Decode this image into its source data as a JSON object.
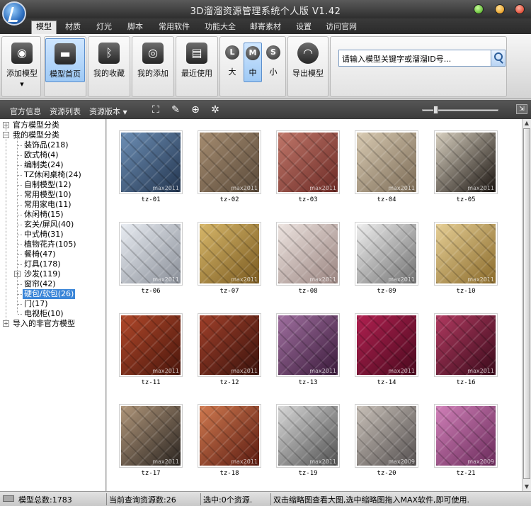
{
  "app": {
    "title": "3D溜溜资源管理系统个人版 V1.42"
  },
  "menu_tabs": [
    "模型",
    "材质",
    "灯光",
    "脚本",
    "常用软件",
    "功能大全",
    "邮寄素材",
    "设置",
    "访问官网"
  ],
  "ribbon": {
    "add_model": "添加模型",
    "model_home": "模型首页",
    "my_favorites": "我的收藏",
    "my_added": "我的添加",
    "recent": "最近使用",
    "size_large_letter": "L",
    "size_large": "大",
    "size_medium_letter": "M",
    "size_medium": "中",
    "size_small_letter": "S",
    "size_small": "小",
    "export_model": "导出模型",
    "search_value": "请输入模型关键字或溜溜ID号..."
  },
  "subtoolbar": {
    "official_info": "官方信息",
    "resource_list": "资源列表",
    "resource_version": "资源版本"
  },
  "tree": {
    "official": "官方模型分类",
    "mine": "我的模型分类",
    "items": [
      "装饰品(218)",
      "欧式椅(4)",
      "编制类(24)",
      "TZ休闲桌椅(24)",
      "自制模型(12)",
      "常用模型(10)",
      "常用家电(11)",
      "休闲椅(15)",
      "玄关/屏风(40)",
      "中式椅(31)",
      "植物花卉(105)",
      "餐椅(47)",
      "灯具(178)",
      "沙发(119)",
      "窗帘(42)",
      "硬包/软包(26)",
      "门(17)",
      "电视柜(10)"
    ],
    "imported": "导入的非官方模型"
  },
  "thumbs": [
    {
      "label": "tz-01",
      "wm": "max2011",
      "c1": "#243650",
      "c2": "#6d8fb5"
    },
    {
      "label": "tz-02",
      "wm": "max2011",
      "c1": "#5a4a3a",
      "c2": "#a58c70"
    },
    {
      "label": "tz-03",
      "wm": "max2011",
      "c1": "#6b2a25",
      "c2": "#c0776a"
    },
    {
      "label": "tz-04",
      "wm": "max2011",
      "c1": "#7a6a55",
      "c2": "#d9cbb3"
    },
    {
      "label": "tz-05",
      "wm": "max2011",
      "c1": "#1a1410",
      "c2": "#d8d0c0"
    },
    {
      "label": "tz-06",
      "wm": "max2011",
      "c1": "#8a8f98",
      "c2": "#e8ecf2"
    },
    {
      "label": "tz-07",
      "wm": "max2011",
      "c1": "#7a5a20",
      "c2": "#d7b76a"
    },
    {
      "label": "tz-08",
      "wm": "max2011",
      "c1": "#9a8480",
      "c2": "#ede4e0"
    },
    {
      "label": "tz-09",
      "wm": "max2011",
      "c1": "#707070",
      "c2": "#efefef"
    },
    {
      "label": "tz-10",
      "wm": "max2011",
      "c1": "#8a6a2a",
      "c2": "#e6cf96"
    },
    {
      "label": "tz-11",
      "wm": "max2011",
      "c1": "#4a160c",
      "c2": "#b0482a"
    },
    {
      "label": "tz-12",
      "wm": "max2011",
      "c1": "#3a120c",
      "c2": "#a0402a"
    },
    {
      "label": "tz-13",
      "wm": "max2011",
      "c1": "#3a1a3a",
      "c2": "#a070a0"
    },
    {
      "label": "tz-14",
      "wm": "max2011",
      "c1": "#4a0a1e",
      "c2": "#b02050"
    },
    {
      "label": "tz-16",
      "wm": "max2011",
      "c1": "#3a0a1a",
      "c2": "#b03a60"
    },
    {
      "label": "tz-17",
      "wm": "max2011",
      "c1": "#2a2420",
      "c2": "#b0967a"
    },
    {
      "label": "tz-18",
      "wm": "max2011",
      "c1": "#5a1a10",
      "c2": "#d07a50"
    },
    {
      "label": "tz-19",
      "wm": "max2011",
      "c1": "#505050",
      "c2": "#d8d8d8"
    },
    {
      "label": "tz-20",
      "wm": "max2009",
      "c1": "#555050",
      "c2": "#c8c0b8"
    },
    {
      "label": "tz-21",
      "wm": "max2009",
      "c1": "#6a2a5a",
      "c2": "#d080b8"
    }
  ],
  "status": {
    "total": "模型总数:1783",
    "query_count": "当前查询资源数:26",
    "selected": "选中:0个资源.",
    "hint": "双击缩略图查看大图,选中缩略图拖入MAX软件,即可使用."
  }
}
